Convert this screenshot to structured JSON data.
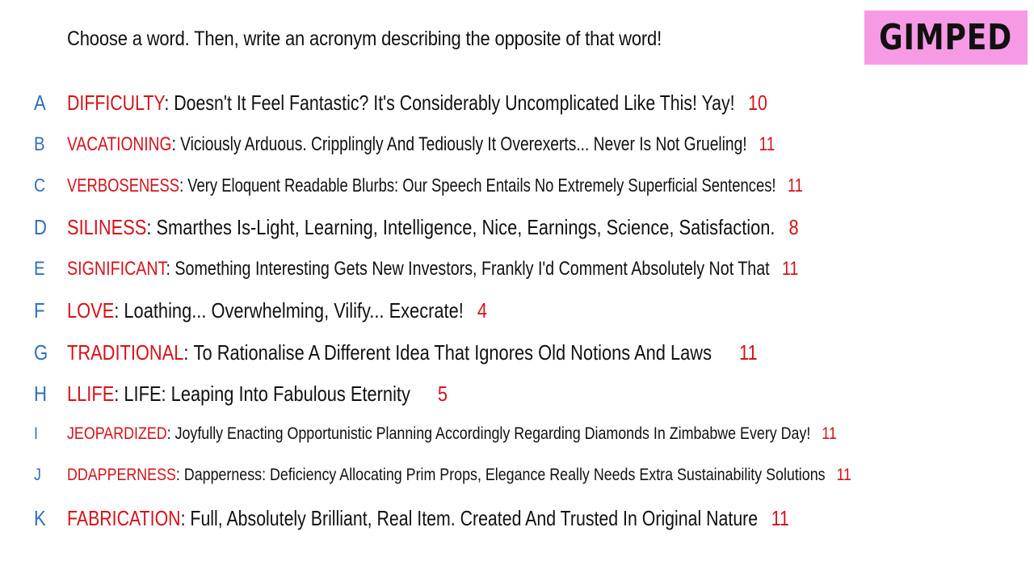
{
  "prompt": "Choose a word. Then, write an acronym describing the opposite of that word!",
  "badge": "GIMPED",
  "rows": [
    {
      "letter": "A",
      "word": "DIFFICULTY",
      "definition": "Doesn't It Feel Fantastic? It's Considerably Uncomplicated Like This! Yay!",
      "score": "10"
    },
    {
      "letter": "B",
      "word": "VACATIONING",
      "definition": "Viciously Arduous. Cripplingly And Tediously It Overexerts... Never Is Not Grueling!",
      "score": "11"
    },
    {
      "letter": "C",
      "word": "VERBOSENESS",
      "definition": "Very Eloquent Readable Blurbs: Our Speech Entails No Extremely Superficial Sentences!",
      "score": "11"
    },
    {
      "letter": "D",
      "word": "SILINESS",
      "definition": "Smarthes Is-Light, Learning, Intelligence, Nice, Earnings, Science, Satisfaction.",
      "score": "8"
    },
    {
      "letter": "E",
      "word": "SIGNIFICANT",
      "definition": "Something Interesting Gets New Investors, Frankly I'd Comment Absolutely Not That",
      "score": "11"
    },
    {
      "letter": "F",
      "word": "LOVE",
      "definition": "Loathing... Overwhelming, Vilify... Execrate!",
      "score": "4"
    },
    {
      "letter": "G",
      "word": "TRADITIONAL",
      "definition": "To Rationalise A Different Idea That Ignores Old Notions And Laws",
      "score": "11"
    },
    {
      "letter": "H",
      "word": "LLIFE",
      "definition": "LIFE: Leaping Into Fabulous Eternity",
      "score": "5"
    },
    {
      "letter": "I",
      "word": "JEOPARDIZED",
      "definition": "Joyfully Enacting Opportunistic Planning Accordingly Regarding Diamonds In Zimbabwe Every Day!",
      "score": "11"
    },
    {
      "letter": "J",
      "word": "DDAPPERNESS",
      "definition": "Dapperness: Deficiency Allocating Prim Props, Elegance Really Needs Extra Sustainability Solutions",
      "score": "11"
    },
    {
      "letter": "K",
      "word": "FABRICATION",
      "definition": "Full, Absolutely Brilliant, Real Item. Created And Trusted In Original Nature",
      "score": "11"
    }
  ]
}
